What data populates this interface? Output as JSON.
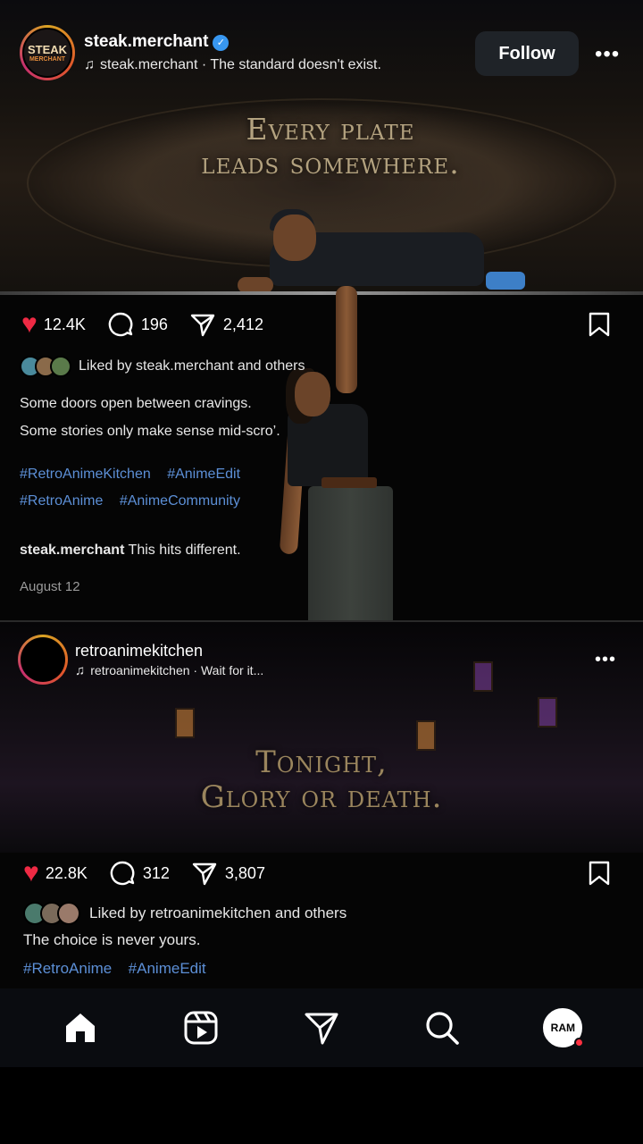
{
  "post1": {
    "avatar_text_top": "STEAK",
    "avatar_text_bottom": "MERCHANT",
    "username": "steak.merchant",
    "verified_icon": "verified-badge-icon",
    "audio_text": "steak.merchant · The standard doesn't exist.",
    "follow_label": "Follow",
    "overlay_line1": "Every plate",
    "overlay_line2": "leads somewhere.",
    "likes": "12.4K",
    "comments": "196",
    "shares": "2,412",
    "liked_by": "Liked by steak.merchant and others",
    "caption_line1": "Some doors open between cravings.",
    "caption_line2": "Some stories only make sense mid-scro’.",
    "hashtags": [
      "#RetroAnimeKitchen",
      "#AnimeEdit",
      "#RetroAnime",
      "#AnimeCommunity"
    ],
    "comment_user": "steak.merchant",
    "comment_text": "This hits different.",
    "date": "August 12"
  },
  "post2": {
    "username": "retroanimekitchen",
    "audio_text": "retroanimekitchen · Wait for it...",
    "overlay_line1": "Tonight,",
    "overlay_line2": "Glory or death.",
    "likes": "22.8K",
    "comments": "312",
    "shares": "3,807",
    "liked_by": "Liked by retroanimekitchen and others",
    "caption": "The choice is never yours.",
    "hashtags": [
      "#RetroAnime",
      "#AnimeEdit"
    ]
  },
  "nav": {
    "items": [
      "home-icon",
      "reels-icon",
      "direct-send-icon",
      "search-icon",
      "profile-avatar"
    ],
    "profile_text": "RAM"
  },
  "colors": {
    "like_red": "#ef2a44",
    "hashtag_blue": "#5c8fd6",
    "verified_blue": "#3897f0",
    "overlay_gold": "#b3a27f"
  }
}
